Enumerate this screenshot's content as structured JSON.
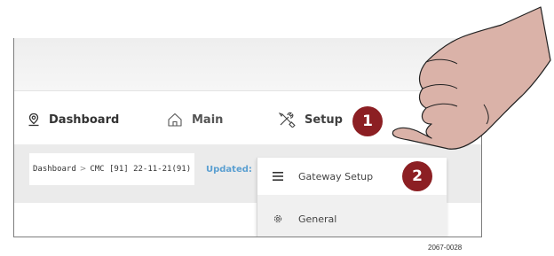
{
  "nav": {
    "dashboard_label": "Dashboard",
    "main_label": "Main",
    "setup_label": "Setup"
  },
  "breadcrumb": {
    "root": "Dashboard",
    "separator": ">",
    "current": "CMC [91] 22-11-21(91)"
  },
  "status": {
    "updated_label": "Updated:"
  },
  "dropdown": {
    "items": [
      {
        "label": "Gateway Setup",
        "icon": "menu-lines-icon"
      },
      {
        "label": "General",
        "icon": "gear-icon"
      }
    ]
  },
  "callouts": {
    "step1": "1",
    "step2": "2"
  },
  "figure_id": "2067-0028",
  "colors": {
    "callout": "#8c1f23",
    "updated_text": "#5a9fd1",
    "hand_fill": "#dab2a8"
  }
}
